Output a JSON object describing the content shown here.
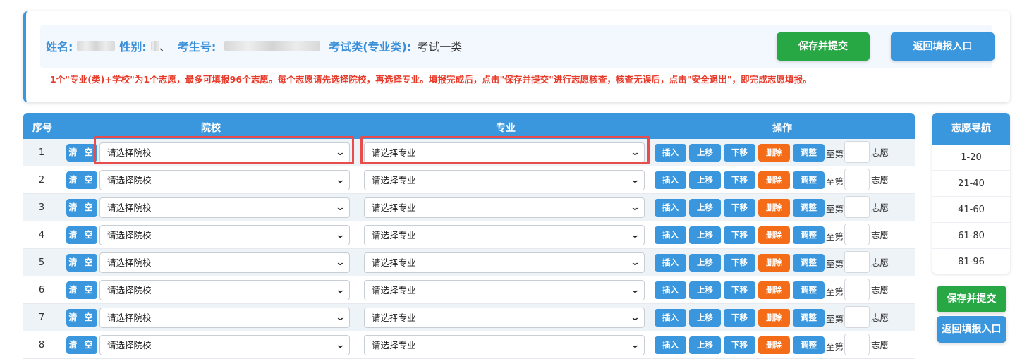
{
  "header": {
    "name_label": "姓名:",
    "gender_label": "性别:",
    "gender_suffix": "、",
    "exam_no_label": "考生号:",
    "exam_type_label": "考试类(专业类):",
    "exam_type_value": "考试一类",
    "save_submit": "保存并提交",
    "return_entry": "返回填报入口",
    "notice": "1个\"专业(类)+学校\"为1个志愿，最多可填报96个志愿。每个志愿请先选择院校，再选择专业。填报完成后，点击\"保存并提交\"进行志愿核查，核查无误后，点击\"安全退出\"，即完成志愿填报。"
  },
  "table": {
    "columns": {
      "index": "序号",
      "school": "院校",
      "major": "专业",
      "actions": "操作"
    },
    "clear_label": "清 空",
    "school_placeholder": "请选择院校",
    "major_placeholder": "请选择专业",
    "actions": {
      "insert": "插入",
      "up": "上移",
      "down": "下移",
      "delete": "删除",
      "adjust": "调整"
    },
    "to_label": "至第",
    "wish_label": "志愿",
    "rows": [
      "1",
      "2",
      "3",
      "4",
      "5",
      "6",
      "7",
      "8"
    ]
  },
  "nav": {
    "title": "志愿导航",
    "items": [
      "1-20",
      "21-40",
      "41-60",
      "61-80",
      "81-96"
    ],
    "save_submit": "保存并提交",
    "return_entry": "返回填报入口"
  },
  "colors": {
    "primary": "#3a96dd",
    "success": "#28a745",
    "danger": "#f46c17",
    "notice": "#e83a2a",
    "highlight": "#e84c4c"
  }
}
